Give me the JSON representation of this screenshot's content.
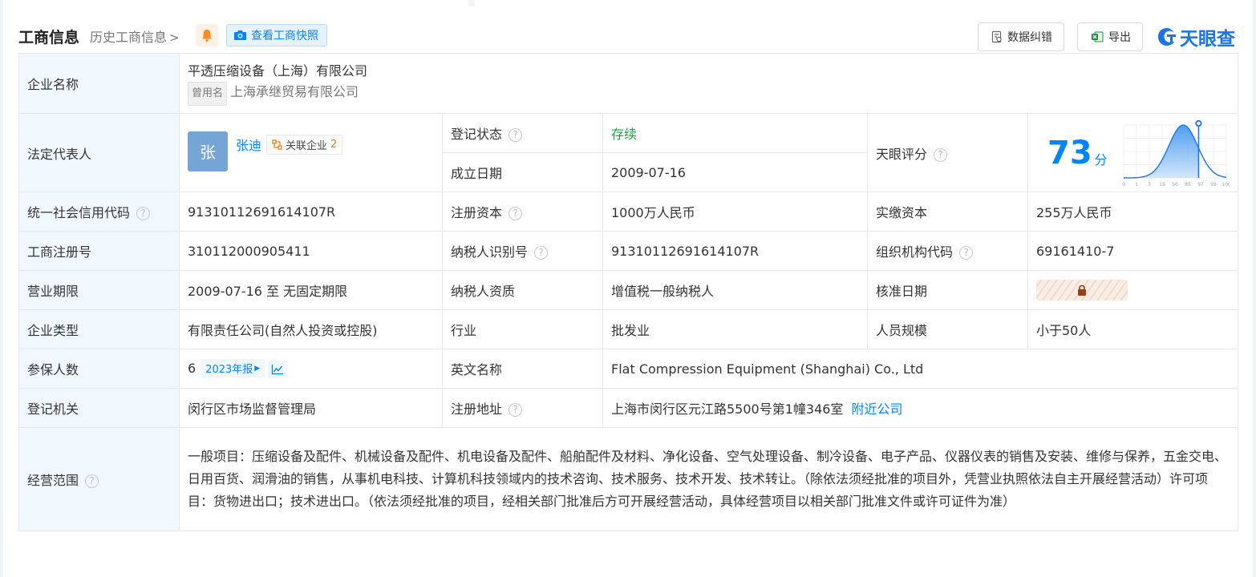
{
  "header": {
    "title": "工商信息",
    "history_link": "历史工商信息",
    "snapshot_button": "查看工商快照",
    "fix_button": "数据纠错",
    "export_button": "导出",
    "logo_text": "天眼查"
  },
  "company": {
    "name_label": "企业名称",
    "name": "平透压缩设备（上海）有限公司",
    "former_tag": "曾用名",
    "former_name": "上海承继贸易有限公司"
  },
  "legal": {
    "label": "法定代表人",
    "avatar_char": "张",
    "name": "张迪",
    "related_label": "关联企业",
    "related_count": "2"
  },
  "status": {
    "label": "登记状态",
    "value": "存续"
  },
  "founded": {
    "label": "成立日期",
    "value": "2009-07-16"
  },
  "score": {
    "label": "天眼评分",
    "value": "73",
    "unit": "分",
    "level": 73,
    "axis": [
      "0",
      "1",
      "3",
      "15",
      "50",
      "85",
      "97",
      "99",
      "100"
    ]
  },
  "rows": {
    "credit_label": "统一社会信用代码",
    "credit_value": "91310112691614107R",
    "reg_capital_label": "注册资本",
    "reg_capital_value": "1000万人民币",
    "paid_capital_label": "实缴资本",
    "paid_capital_value": "255万人民币",
    "reg_no_label": "工商注册号",
    "reg_no_value": "310112000905411",
    "taxpayer_id_label": "纳税人识别号",
    "taxpayer_id_value": "91310112691614107R",
    "org_code_label": "组织机构代码",
    "org_code_value": "69161410-7",
    "term_label": "营业期限",
    "term_value": "2009-07-16 至 无固定期限",
    "tax_qual_label": "纳税人资质",
    "tax_qual_value": "增值税一般纳税人",
    "approve_label": "核准日期",
    "type_label": "企业类型",
    "type_value": "有限责任公司(自然人投资或控股)",
    "industry_label": "行业",
    "industry_value": "批发业",
    "staff_label": "人员规模",
    "staff_value": "小于50人",
    "insured_label": "参保人数",
    "insured_value": "6",
    "report_tag": "2023年报",
    "en_name_label": "英文名称",
    "en_name_value": "Flat Compression Equipment (Shanghai) Co., Ltd",
    "authority_label": "登记机关",
    "authority_value": "闵行区市场监督管理局",
    "address_label": "注册地址",
    "address_value": "上海市闵行区元江路5500号第1幢346室",
    "nearby_link": "附近公司",
    "scope_label": "经营范围",
    "scope_value": "一般项目：压缩设备及配件、机械设备及配件、机电设备及配件、船舶配件及材料、净化设备、空气处理设备、制冷设备、电子产品、仪器仪表的销售及安装、维修与保养，五金交电、日用百货、润滑油的销售，从事机电科技、计算机科技领域内的技术咨询、技术服务、技术开发、技术转让。（除依法须经批准的项目外，凭营业执照依法自主开展经营活动）许可项目：货物进出口；技术进出口。（依法须经批准的项目，经相关部门批准后方可开展经营活动，具体经营项目以相关部门批准文件或许可证件为准）"
  },
  "colors": {
    "accent": "#0084ff",
    "label_bg": "#f2f9fe",
    "status_green": "#1aa34a",
    "logo_blue": "#1b73e8"
  }
}
